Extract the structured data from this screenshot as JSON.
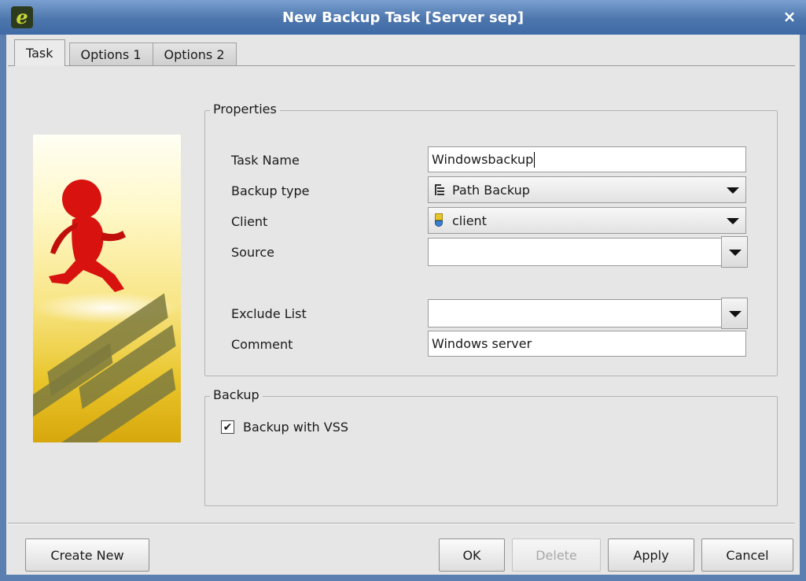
{
  "window": {
    "title": "New Backup Task [Server sep]",
    "app_icon_letter": "e",
    "close_glyph": "×"
  },
  "tabs": [
    {
      "label": "Task",
      "active": true
    },
    {
      "label": "Options 1",
      "active": false
    },
    {
      "label": "Options 2",
      "active": false
    }
  ],
  "properties": {
    "legend": "Properties",
    "task_name": {
      "label": "Task Name",
      "value": "Windowsbackup"
    },
    "backup_type": {
      "label": "Backup type",
      "value": "Path Backup",
      "icon": "path-backup-icon"
    },
    "client": {
      "label": "Client",
      "value": "client",
      "icon": "client-icon"
    },
    "source": {
      "label": "Source",
      "value": ""
    },
    "exclude_list": {
      "label": "Exclude List",
      "value": ""
    },
    "comment": {
      "label": "Comment",
      "value": "Windows server"
    }
  },
  "backup": {
    "legend": "Backup",
    "vss": {
      "label": "Backup with VSS",
      "checked": true,
      "check_glyph": "✔"
    }
  },
  "buttons": {
    "create_new": "Create New",
    "ok": "OK",
    "delete": "Delete",
    "apply": "Apply",
    "cancel": "Cancel"
  },
  "colors": {
    "titlebar": "#4d76ad",
    "window_bg": "#e6e6e6"
  }
}
